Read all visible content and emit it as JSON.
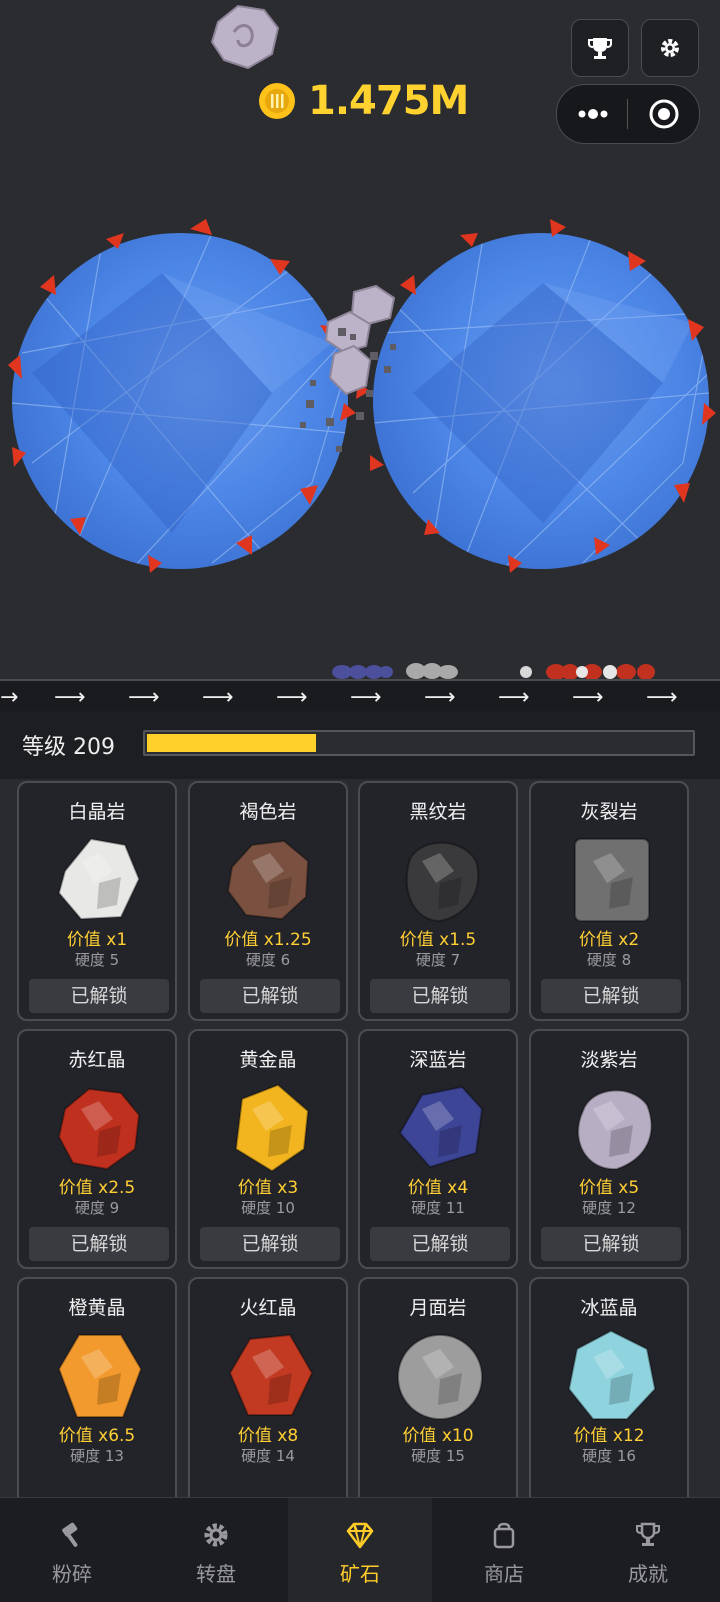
{
  "header": {
    "coins": "1.475M",
    "trophy_icon": "trophy-icon",
    "settings_icon": "gear-icon",
    "capsule_more_icon": "more-dots-icon",
    "capsule_close_icon": "target-icon"
  },
  "level": {
    "label": "等级 209",
    "progress": 0.31,
    "fill_color": "#ffd12a"
  },
  "ores": [
    {
      "name": "白晶岩",
      "value": "价值 x1",
      "hardness": "硬度 5",
      "button": "已解锁",
      "color": "#e8e8e6"
    },
    {
      "name": "褐色岩",
      "value": "价值 x1.25",
      "hardness": "硬度 6",
      "button": "已解锁",
      "color": "#7a5140"
    },
    {
      "name": "黑纹岩",
      "value": "价值 x1.5",
      "hardness": "硬度 7",
      "button": "已解锁",
      "color": "#3a3a3c"
    },
    {
      "name": "灰裂岩",
      "value": "价值 x2",
      "hardness": "硬度 8",
      "button": "已解锁",
      "color": "#707070"
    },
    {
      "name": "赤红晶",
      "value": "价值 x2.5",
      "hardness": "硬度 9",
      "button": "已解锁",
      "color": "#c0301e"
    },
    {
      "name": "黄金晶",
      "value": "价值 x3",
      "hardness": "硬度 10",
      "button": "已解锁",
      "color": "#f2b51f"
    },
    {
      "name": "深蓝岩",
      "value": "价值 x4",
      "hardness": "硬度 11",
      "button": "已解锁",
      "color": "#3d4596"
    },
    {
      "name": "淡紫岩",
      "value": "价值 x5",
      "hardness": "硬度 12",
      "button": "已解锁",
      "color": "#b8aec4"
    },
    {
      "name": "橙黄晶",
      "value": "价值 x6.5",
      "hardness": "硬度 13",
      "button": "",
      "color": "#f29a2e"
    },
    {
      "name": "火红晶",
      "value": "价值 x8",
      "hardness": "硬度 14",
      "button": "",
      "color": "#c23a22"
    },
    {
      "name": "月面岩",
      "value": "价值 x10",
      "hardness": "硬度 15",
      "button": "",
      "color": "#9d9d9d"
    },
    {
      "name": "冰蓝晶",
      "value": "价值 x12",
      "hardness": "硬度 16",
      "button": "",
      "color": "#8fd3de"
    }
  ],
  "nav": [
    {
      "label": "粉碎",
      "icon": "hammer-icon",
      "active": false
    },
    {
      "label": "转盘",
      "icon": "gear-icon",
      "active": false
    },
    {
      "label": "矿石",
      "icon": "diamond-icon",
      "active": true
    },
    {
      "label": "商店",
      "icon": "bag-icon",
      "active": false
    },
    {
      "label": "成就",
      "icon": "trophy-icon",
      "active": false
    }
  ]
}
